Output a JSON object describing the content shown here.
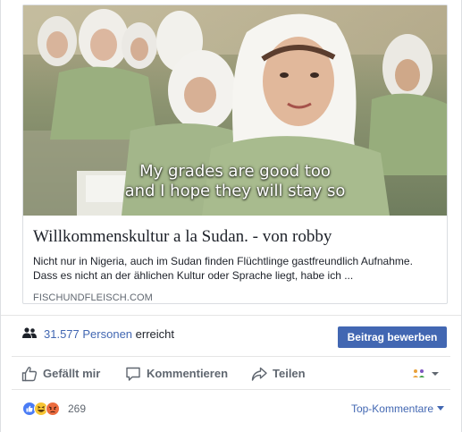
{
  "link_preview": {
    "caption_line1": "My grades are good too",
    "caption_line2": "and I hope they will stay so",
    "title": "Willkommenskultur a la Sudan. - von robby",
    "description": "Nicht nur in Nigeria, auch im Sudan finden Flüchtlinge gastfreundlich Aufnahme. Dass es nicht an der ählichen Kultur oder Sprache liegt, habe ich ...",
    "domain": "FISCHUNDFLEISCH.COM"
  },
  "reach": {
    "count": "31.577 Personen",
    "suffix": " erreicht",
    "boost_label": "Beitrag bewerben"
  },
  "actions": {
    "like_label": "Gefällt mir",
    "comment_label": "Kommentieren",
    "share_label": "Teilen"
  },
  "reactions": {
    "types": [
      "like",
      "haha",
      "angry"
    ],
    "count": "269",
    "sort_label": "Top-Kommentare"
  },
  "colors": {
    "link_blue": "#4267b2",
    "secondary_text": "#606770"
  }
}
